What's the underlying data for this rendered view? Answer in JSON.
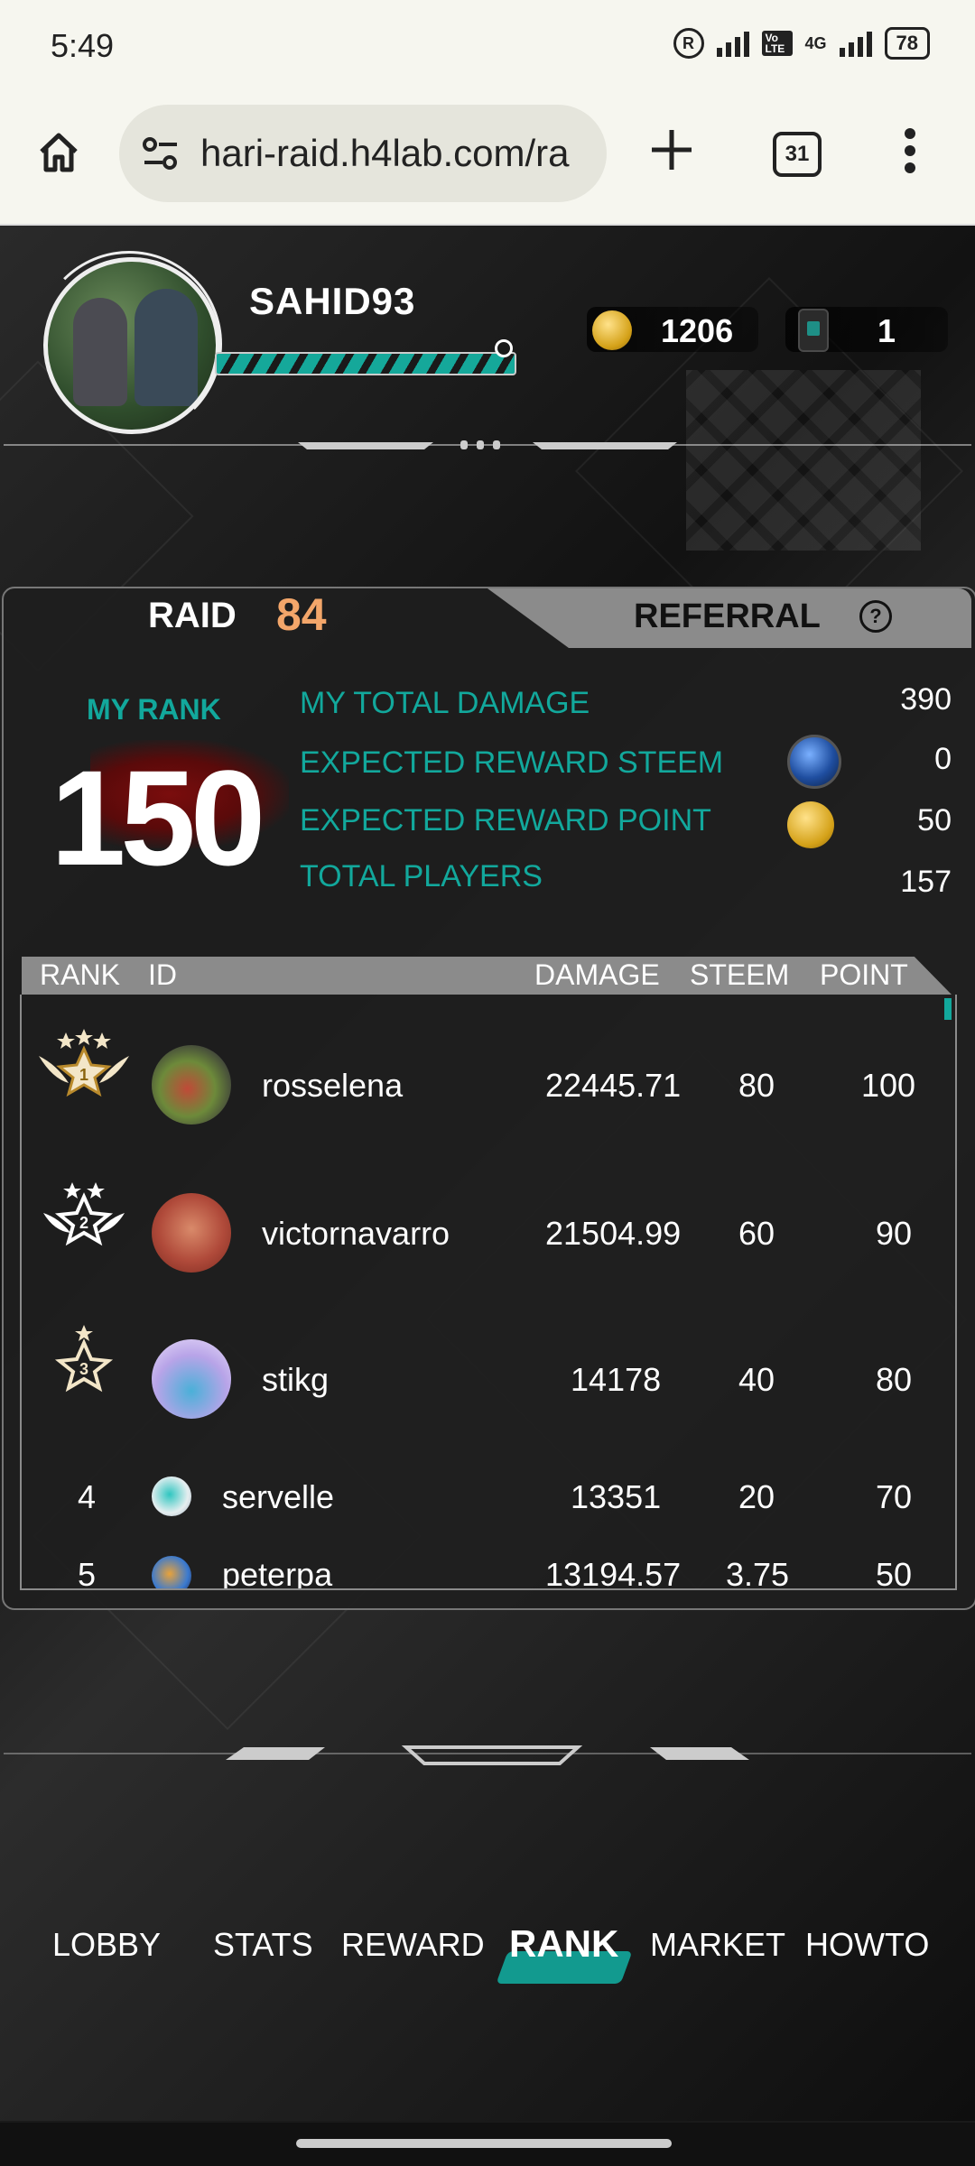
{
  "status_bar": {
    "time": "5:49",
    "network": "4G",
    "volte": "Vo LTE",
    "battery": "78"
  },
  "browser": {
    "url": "hari-raid.h4lab.com/ra",
    "tab_count": "31"
  },
  "profile": {
    "username": "SAHID93",
    "coins": "1206",
    "tickets": "1"
  },
  "tabs": {
    "raid_label": "RAID",
    "raid_number": "84",
    "referral_label": "REFERRAL"
  },
  "my_rank": {
    "label": "MY RANK",
    "value": "150",
    "stats": [
      {
        "label": "MY TOTAL DAMAGE",
        "value": "390"
      },
      {
        "label": "EXPECTED REWARD STEEM",
        "value": "0"
      },
      {
        "label": "EXPECTED REWARD POINT",
        "value": "50"
      },
      {
        "label": "TOTAL PLAYERS",
        "value": "157"
      }
    ]
  },
  "table": {
    "headers": {
      "rank": "RANK",
      "id": "ID",
      "damage": "DAMAGE",
      "steem": "STEEM",
      "point": "POINT"
    },
    "rows": [
      {
        "rank": "1",
        "id": "rosselena",
        "damage": "22445.71",
        "steem": "80",
        "point": "100"
      },
      {
        "rank": "2",
        "id": "victornavarro",
        "damage": "21504.99",
        "steem": "60",
        "point": "90"
      },
      {
        "rank": "3",
        "id": "stikg",
        "damage": "14178",
        "steem": "40",
        "point": "80"
      },
      {
        "rank": "4",
        "id": "servelle",
        "damage": "13351",
        "steem": "20",
        "point": "70"
      },
      {
        "rank": "5",
        "id": "peterpa",
        "damage": "13194.57",
        "steem": "3.75",
        "point": "50"
      }
    ]
  },
  "nav": {
    "items": [
      "LOBBY",
      "STATS",
      "REWARD",
      "RANK",
      "MARKET",
      "HOWTO"
    ],
    "active": "RANK"
  },
  "colors": {
    "accent_teal": "#12a89c",
    "raid_number": "#f3a66a"
  }
}
